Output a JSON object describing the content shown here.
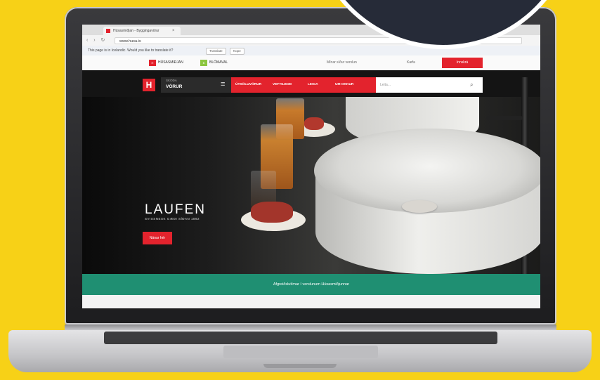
{
  "browser": {
    "tab_title": "Húsasmiðjan - Byggingavörur",
    "tab_close": "×",
    "nav_icons": "‹ › ↻",
    "url": "www.husa.is",
    "translate_prompt": "This page is in Icelandic. Would you like to translate it?",
    "translate_button": "Translate",
    "nope_button": "Nope"
  },
  "utility": {
    "store_label": "HÚSASMIÐJAN",
    "store_badge": "H",
    "blomaval_label": "BLÓMAVAL",
    "blomaval_badge": "B",
    "account_label": "Mínar síður verslun",
    "cart_label": "Karfa",
    "cart_button": "Innskrá"
  },
  "header": {
    "logo": "H",
    "products_sub": "SKOÐA",
    "products_main": "VÖRUR",
    "hamburger": "≡",
    "nav": [
      "ÚTSÖLUVÖRUR",
      "VEFTILBOÐ",
      "LEIGA",
      "UM OKKUR"
    ],
    "search_placeholder": "Leita...",
    "search_icon": "⌕"
  },
  "hero": {
    "brand": "LAUFEN",
    "tagline": "SVISSNESK GÆÐI SÍÐAN 1892",
    "cta": "Nánar hér"
  },
  "notice": {
    "text": "Afgreiðslutímar í verslunum Húsasmiðjunnar"
  },
  "colors": {
    "background": "#f7d117",
    "brand_red": "#e3232d",
    "notice_green": "#1f8f72",
    "sticker_navy": "#262b38"
  }
}
